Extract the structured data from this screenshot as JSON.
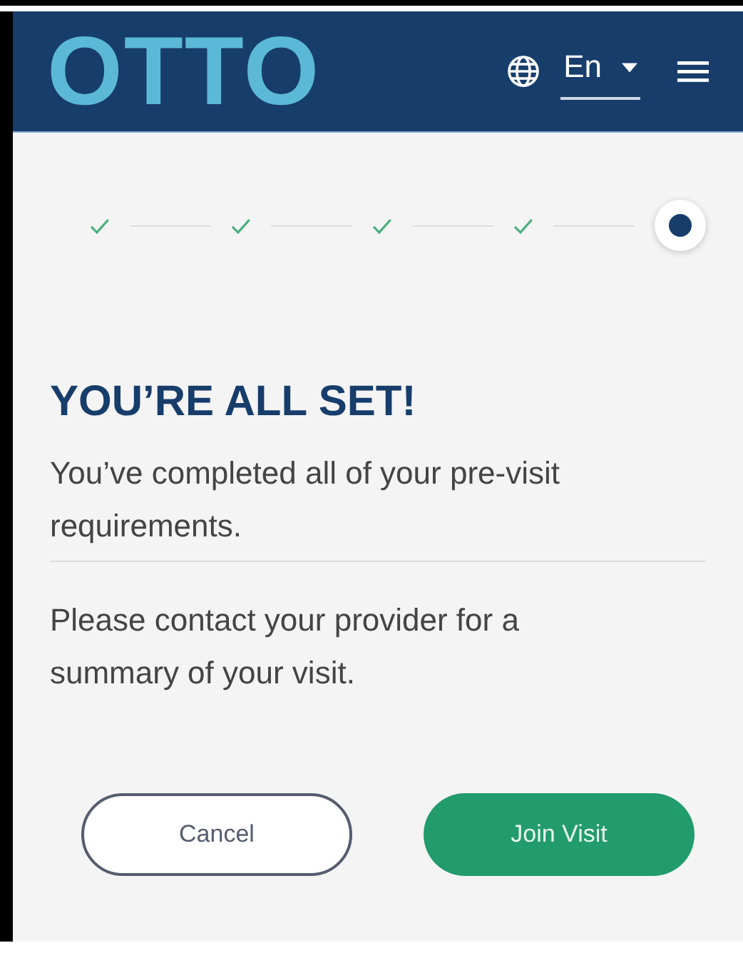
{
  "header": {
    "logo": "OTTO",
    "language": "En"
  },
  "steps": [
    {
      "completed": true
    },
    {
      "completed": true
    },
    {
      "completed": true
    },
    {
      "completed": true
    },
    {
      "completed": false
    }
  ],
  "title": "YOU’RE ALL SET!",
  "message": "You’ve completed all of your pre-visit requirements.",
  "note": "Please contact your provider for a summary of your visit.",
  "buttons": [
    {
      "label": "Cancel",
      "kind": "secondary"
    },
    {
      "label": "Join Visit",
      "kind": "primary"
    }
  ]
}
